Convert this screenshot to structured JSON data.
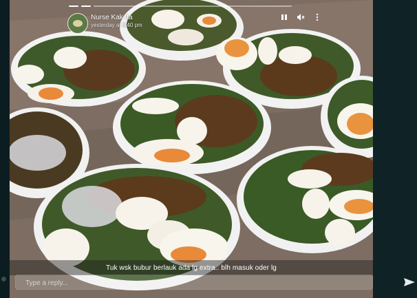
{
  "story": {
    "poster_name": "Nurse Kak Ita",
    "timestamp": "yesterday at 3:40 pm",
    "caption": "Tuk wsk bubur berlauk ada lg extra.. blh masuk oder lg",
    "progress": {
      "total_segments": 3,
      "current_segment": 3
    }
  },
  "reply": {
    "placeholder": "Type a reply..."
  },
  "icons": {
    "pause": "pause-icon",
    "mute": "speaker-muted-icon",
    "menu": "more-vertical-icon",
    "send": "send-icon"
  },
  "colors": {
    "background": "#0f2226",
    "caption_text": "#ffffff"
  }
}
